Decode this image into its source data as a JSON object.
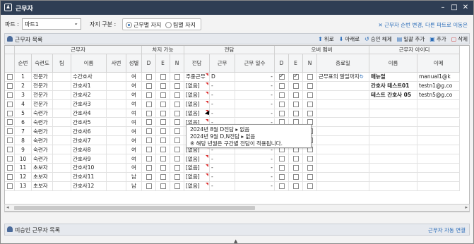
{
  "window": {
    "title": "근무자",
    "icon": "person-icon"
  },
  "filter": {
    "part_label": "파트 :",
    "part_value": "파트1",
    "seat_label": "자지 구분 :",
    "radio1": "근무별 자지",
    "radio2": "팀별 자지",
    "link": "✕ 근무자 순번 변경, 다른 파트로 이동은"
  },
  "panel": {
    "title": "근무자 목록",
    "tools": [
      {
        "icon": "arrow-up-icon",
        "label": "위로"
      },
      {
        "icon": "arrow-down-icon",
        "label": "아래로"
      },
      {
        "icon": "undo-icon",
        "label": "승인 해제"
      },
      {
        "icon": "batch-add-icon",
        "label": "일괄 추가"
      },
      {
        "icon": "add-icon",
        "label": "추가"
      },
      {
        "icon": "delete-icon",
        "label": "삭제"
      }
    ]
  },
  "headers": {
    "group_worker": "근무자",
    "group_avail": "차지 가능",
    "group_duty": "전담",
    "group_over": "오버 멤버",
    "group_account": "근무자 아이디",
    "seq": "순번",
    "skill": "숙련도",
    "team": "팀",
    "name": "이름",
    "empno": "사번",
    "gender": "성별",
    "d": "D",
    "e": "E",
    "n": "N",
    "duty": "전담",
    "work": "근무",
    "workdays": "근무 일수",
    "od": "D",
    "oe": "E",
    "on": "N",
    "enddate": "종료일",
    "acc_name": "이름",
    "acc_mail": "이메"
  },
  "rows": [
    {
      "seq": "1",
      "skill": "전문가",
      "name": "수간호사",
      "gender": "여",
      "d": false,
      "e": false,
      "n": false,
      "duty": "주중근무",
      "work": "D",
      "days": "-",
      "od": true,
      "oe": true,
      "on": false,
      "enddate": "근무표의 말일까지",
      "acc_name": "매뉴얼",
      "acc_mail": "manual1@k"
    },
    {
      "seq": "2",
      "skill": "전문가",
      "name": "간호사1",
      "gender": "여",
      "d": false,
      "e": false,
      "n": false,
      "duty": "[없음]",
      "work": "-",
      "days": "-",
      "od": false,
      "oe": false,
      "on": false,
      "enddate": "",
      "acc_name": "간호사 테스트01",
      "acc_mail": "testn1@g.co"
    },
    {
      "seq": "3",
      "skill": "전문가",
      "name": "간호사2",
      "gender": "여",
      "d": false,
      "e": false,
      "n": false,
      "duty": "[없음]",
      "work": "-",
      "days": "-",
      "od": false,
      "oe": false,
      "on": false,
      "enddate": "",
      "acc_name": "테스트 간호사 05",
      "acc_mail": "testn5@g.co"
    },
    {
      "seq": "4",
      "skill": "전문가",
      "name": "간호사3",
      "gender": "여",
      "d": false,
      "e": false,
      "n": false,
      "duty": "[없음]",
      "work": "-",
      "days": "-",
      "od": false,
      "oe": false,
      "on": false,
      "enddate": "",
      "acc_name": "",
      "acc_mail": ""
    },
    {
      "seq": "5",
      "skill": "숙련가",
      "name": "간호사4",
      "gender": "여",
      "d": false,
      "e": false,
      "n": false,
      "duty": "[없음]",
      "work": "-",
      "days": "-",
      "od": false,
      "oe": false,
      "on": false,
      "enddate": "",
      "acc_name": "",
      "acc_mail": ""
    },
    {
      "seq": "6",
      "skill": "숙련가",
      "name": "간호사5",
      "gender": "여",
      "d": false,
      "e": false,
      "n": false,
      "duty": "[없음]",
      "work": "-",
      "days": "-",
      "od": false,
      "oe": false,
      "on": false,
      "enddate": "",
      "acc_name": "",
      "acc_mail": ""
    },
    {
      "seq": "7",
      "skill": "숙련가",
      "name": "간호사6",
      "gender": "여",
      "d": false,
      "e": false,
      "n": false,
      "duty": "[없음]",
      "work": "-",
      "days": "-",
      "od": false,
      "oe": false,
      "on": false,
      "enddate": "",
      "acc_name": "",
      "acc_mail": ""
    },
    {
      "seq": "8",
      "skill": "숙련가",
      "name": "간호사7",
      "gender": "여",
      "d": false,
      "e": false,
      "n": false,
      "duty": "[없음]",
      "work": "-",
      "days": "-",
      "od": false,
      "oe": false,
      "on": false,
      "enddate": "",
      "acc_name": "",
      "acc_mail": ""
    },
    {
      "seq": "9",
      "skill": "숙련가",
      "name": "간호사8",
      "gender": "여",
      "d": false,
      "e": false,
      "n": false,
      "duty": "[없음]",
      "work": "-",
      "days": "-",
      "od": false,
      "oe": false,
      "on": false,
      "enddate": "",
      "acc_name": "",
      "acc_mail": ""
    },
    {
      "seq": "10",
      "skill": "숙련가",
      "name": "간호사9",
      "gender": "여",
      "d": false,
      "e": false,
      "n": false,
      "duty": "[없음]",
      "work": "-",
      "days": "-",
      "od": false,
      "oe": false,
      "on": false,
      "enddate": "",
      "acc_name": "",
      "acc_mail": ""
    },
    {
      "seq": "11",
      "skill": "초보자",
      "name": "간호사10",
      "gender": "여",
      "d": false,
      "e": false,
      "n": false,
      "duty": "[없음]",
      "work": "-",
      "days": "-",
      "od": false,
      "oe": false,
      "on": false,
      "enddate": "",
      "acc_name": "",
      "acc_mail": ""
    },
    {
      "seq": "12",
      "skill": "초보자",
      "name": "간호사11",
      "gender": "남",
      "d": false,
      "e": false,
      "n": false,
      "duty": "[없음]",
      "work": "-",
      "days": "-",
      "od": false,
      "oe": false,
      "on": false,
      "enddate": "",
      "acc_name": "",
      "acc_mail": ""
    },
    {
      "seq": "13",
      "skill": "초보자",
      "name": "간호사12",
      "gender": "남",
      "d": false,
      "e": false,
      "n": false,
      "duty": "[없음]",
      "work": "-",
      "days": "-",
      "od": false,
      "oe": false,
      "on": false,
      "enddate": "",
      "acc_name": "",
      "acc_mail": ""
    }
  ],
  "tooltip": {
    "line1": "2024년 8월 D전담 ▸ 없음",
    "line2": "2024년 9월 D,N전담 ▸ 없음",
    "line3": "※ 해당 년월은 구간별 전담이 적용됩니다."
  },
  "bottom": {
    "title": "미승인 근무자 목록",
    "link": "근무자 자동 연결"
  }
}
